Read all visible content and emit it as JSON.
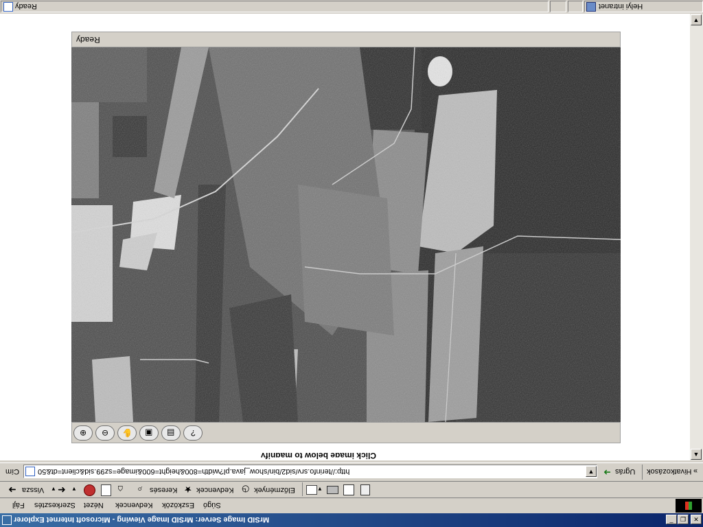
{
  "window": {
    "title": "MrSID Image Server: MrSID Image Viewing - Microsoft Internet Explorer"
  },
  "menu": [
    "Fájl",
    "Szerkesztés",
    "Nézet",
    "Kedvencek",
    "Eszközök",
    "Súgó"
  ],
  "toolbar": {
    "back": "Vissza",
    "search": "Keresés",
    "favorites": "Kedvencek",
    "history": "Előzmények"
  },
  "address": {
    "label": "Cím",
    "url": "http://terinfo.srv/sid2/bin/show_java.pl?width=800&height=600&image=sz99.sid&client=dt&50",
    "go": "Ugrás",
    "links": "Hivatkozások"
  },
  "applet": {
    "status": "Ready",
    "page_text": "Click image below to magnify"
  },
  "statusbar": {
    "text": "Ready",
    "zone": "Helyi intranet"
  }
}
